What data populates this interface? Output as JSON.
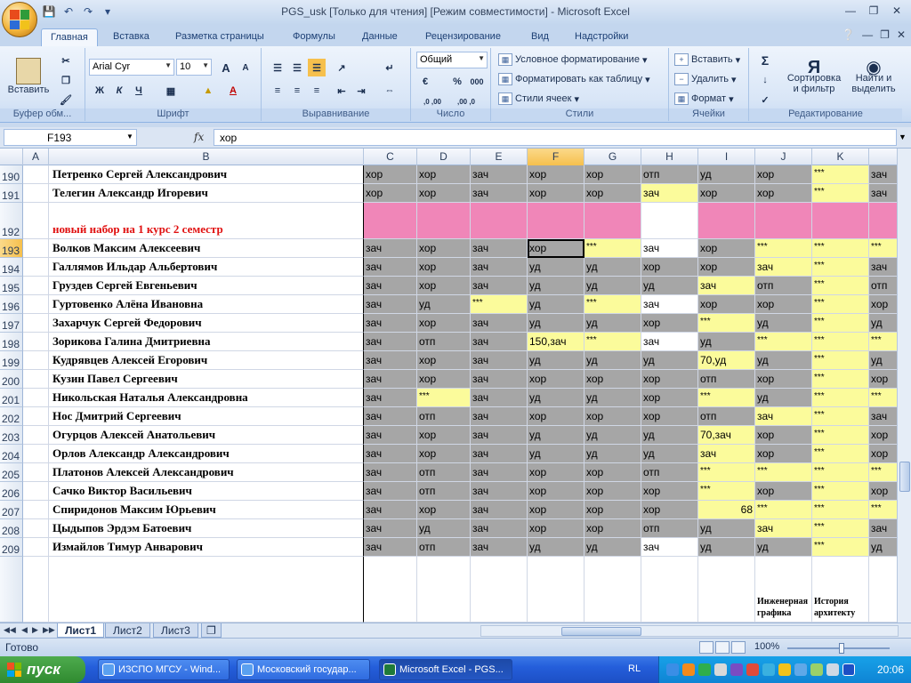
{
  "window": {
    "title": "PGS_usk  [Только для чтения]  [Режим совместимости] - Microsoft Excel"
  },
  "tabs": [
    "Главная",
    "Вставка",
    "Разметка страницы",
    "Формулы",
    "Данные",
    "Рецензирование",
    "Вид",
    "Надстройки"
  ],
  "ribbon": {
    "clipboard": {
      "label": "Буфер обм...",
      "paste": "Вставить"
    },
    "font": {
      "label": "Шрифт",
      "name": "Arial Cyr",
      "size": "10",
      "bold": "Ж",
      "italic": "К",
      "underline": "Ч",
      "grow": "A",
      "shrink": "A"
    },
    "alignment": {
      "label": "Выравнивание"
    },
    "number": {
      "label": "Число",
      "format": "Общий",
      "percent": "%",
      "thousands": "000",
      "inc_decimal": ",0 ,00",
      "dec_decimal": ",00 ,0"
    },
    "styles": {
      "label": "Стили",
      "conditional": "Условное форматирование",
      "as_table": "Форматировать как таблицу",
      "cell_styles": "Стили ячеек"
    },
    "cells": {
      "label": "Ячейки",
      "insert": "Вставить",
      "delete": "Удалить",
      "format": "Формат"
    },
    "editing": {
      "label": "Редактирование",
      "sigma": "Σ",
      "sort": "Сортировка",
      "sort2": "и фильтр",
      "find": "Найти и",
      "find2": "выделить"
    }
  },
  "formula_bar": {
    "name_box": "F193",
    "fx": "fx",
    "value": "хор"
  },
  "columns": [
    "A",
    "B",
    "C",
    "D",
    "E",
    "F",
    "G",
    "H",
    "I",
    "J",
    "K"
  ],
  "rows": [
    {
      "num": "190",
      "name": "Петренко Сергей Александрович",
      "c": "хор",
      "d": "хор",
      "e": "зач",
      "f": "хор",
      "g": "хор",
      "h": "отп",
      "i": "уд",
      "j": "хор",
      "k": "***",
      "l": "зач"
    },
    {
      "num": "191",
      "name": "Телегин Александр Игоревич",
      "c": "хор",
      "d": "хор",
      "e": "зач",
      "f": "хор",
      "g": "хор",
      "h": "зач",
      "i": "хор",
      "j": "хор",
      "k": "***",
      "l": "зач"
    },
    {
      "num": "192",
      "name": "новый набор на 1 курс 2 семестр"
    },
    {
      "num": "193",
      "name": "Волков Максим Алексеевич",
      "c": "зач",
      "d": "хор",
      "e": "зач",
      "f": "хор",
      "g": "***",
      "h": "зач",
      "i": "хор",
      "j": "***",
      "k": "***",
      "l": "***"
    },
    {
      "num": "194",
      "name": "Галлямов Ильдар Альбертович",
      "c": "зач",
      "d": "хор",
      "e": "зач",
      "f": "уд",
      "g": "уд",
      "h": "хор",
      "i": "хор",
      "j": "зач",
      "k": "***",
      "l": "зач"
    },
    {
      "num": "195",
      "name": "Груздев Сергей Евгеньевич",
      "c": "зач",
      "d": "хор",
      "e": "зач",
      "f": "уд",
      "g": "уд",
      "h": "уд",
      "i": "зач",
      "j": "отп",
      "k": "***",
      "l": "отп"
    },
    {
      "num": "196",
      "name": "Гуртовенко Алёна Ивановна",
      "c": "зач",
      "d": "уд",
      "e": "***",
      "f": "уд",
      "g": "***",
      "h": "зач",
      "i": "хор",
      "j": "хор",
      "k": "***",
      "l": "хор"
    },
    {
      "num": "197",
      "name": "Захарчук Сергей Федорович",
      "c": "зач",
      "d": "хор",
      "e": "зач",
      "f": "уд",
      "g": "уд",
      "h": "хор",
      "i": "***",
      "j": "уд",
      "k": "***",
      "l": "уд"
    },
    {
      "num": "198",
      "name": "Зорикова Галина Дмитриевна",
      "c": "зач",
      "d": "отп",
      "e": "зач",
      "f": "150,зач",
      "g": "***",
      "h": "зач",
      "i": "уд",
      "j": "***",
      "k": "***",
      "l": "***"
    },
    {
      "num": "199",
      "name": "Кудрявцев Алексей Егорович",
      "c": "зач",
      "d": "хор",
      "e": "зач",
      "f": "уд",
      "g": "уд",
      "h": "уд",
      "i": "70,уд",
      "j": "уд",
      "k": "***",
      "l": "уд"
    },
    {
      "num": "200",
      "name": "Кузин Павел Сергеевич",
      "c": "зач",
      "d": "хор",
      "e": "зач",
      "f": "хор",
      "g": "хор",
      "h": "хор",
      "i": "отп",
      "j": "хор",
      "k": "***",
      "l": "хор"
    },
    {
      "num": "201",
      "name": "Никольская Наталья Александровна",
      "c": "зач",
      "d": "***",
      "e": "зач",
      "f": "уд",
      "g": "уд",
      "h": "хор",
      "i": "***",
      "j": "уд",
      "k": "***",
      "l": "***"
    },
    {
      "num": "202",
      "name": "Нос Дмитрий Сергеевич",
      "c": "зач",
      "d": "отп",
      "e": "зач",
      "f": "хор",
      "g": "хор",
      "h": "хор",
      "i": "отп",
      "j": "зач",
      "k": "***",
      "l": "зач"
    },
    {
      "num": "203",
      "name": "Огурцов Алексей Анатольевич",
      "c": "зач",
      "d": "хор",
      "e": "зач",
      "f": "уд",
      "g": "уд",
      "h": "уд",
      "i": "70,зач",
      "j": "хор",
      "k": "***",
      "l": "хор"
    },
    {
      "num": "204",
      "name": "Орлов Александр Александрович",
      "c": "зач",
      "d": "хор",
      "e": "зач",
      "f": "уд",
      "g": "уд",
      "h": "уд",
      "i": "зач",
      "j": "хор",
      "k": "***",
      "l": "хор"
    },
    {
      "num": "205",
      "name": "Платонов Алексей Александрович",
      "c": "зач",
      "d": "отп",
      "e": "зач",
      "f": "хор",
      "g": "хор",
      "h": "отп",
      "i": "***",
      "j": "***",
      "k": "***",
      "l": "***"
    },
    {
      "num": "206",
      "name": "Сачко Виктор Васильевич",
      "c": "зач",
      "d": "отп",
      "e": "зач",
      "f": "хор",
      "g": "хор",
      "h": "хор",
      "i": "***",
      "j": "хор",
      "k": "***",
      "l": "хор"
    },
    {
      "num": "207",
      "name": "Спиридонов Максим Юрьевич",
      "c": "зач",
      "d": "хор",
      "e": "зач",
      "f": "хор",
      "g": "хор",
      "h": "хор",
      "i": "68",
      "j": "***",
      "k": "***",
      "l": "***"
    },
    {
      "num": "208",
      "name": "Цыдыпов Эрдэм Батоевич",
      "c": "зач",
      "d": "уд",
      "e": "зач",
      "f": "хор",
      "g": "хор",
      "h": "отп",
      "i": "уд",
      "j": "зач",
      "k": "***",
      "l": "зач"
    },
    {
      "num": "209",
      "name": "Измайлов Тимур Анварович",
      "c": "зач",
      "d": "отп",
      "e": "зач",
      "f": "уд",
      "g": "уд",
      "h": "зач",
      "i": "уд",
      "j": "уд",
      "k": "***",
      "l": "уд"
    }
  ],
  "header_row": {
    "j": "Инженерная графика",
    "k": "История архитекту"
  },
  "sheets": [
    "Лист1",
    "Лист2",
    "Лист3"
  ],
  "status": {
    "ready": "Готово",
    "zoom": "100%"
  },
  "taskbar": {
    "start": "пуск",
    "items": [
      "ИЗСПО МГСУ - Wind...",
      "Московский государ...",
      "Microsoft Excel - PGS..."
    ],
    "lang": "RL",
    "clock": "20:06"
  }
}
